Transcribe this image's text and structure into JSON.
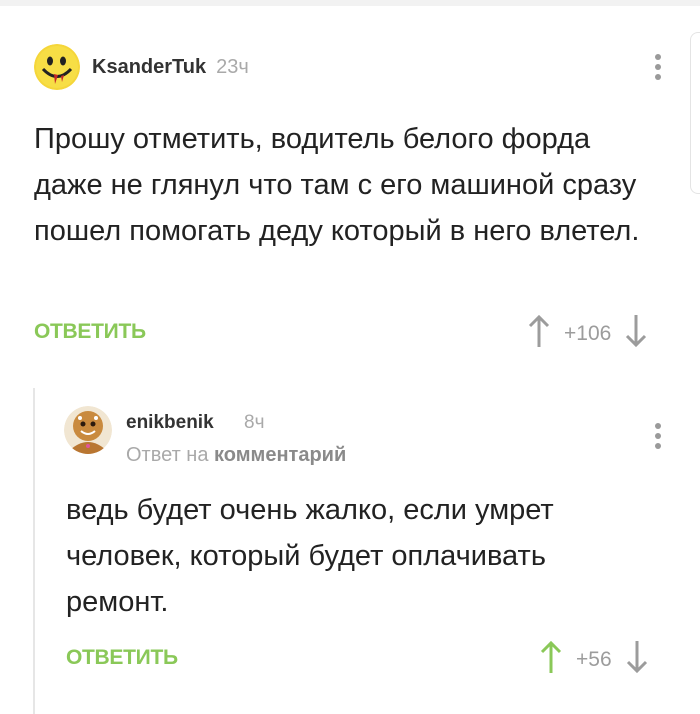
{
  "comments": [
    {
      "username": "KsanderTuk",
      "time": "23ч",
      "avatar_icon": "smiley-avatar-icon",
      "text": "Прошу отметить, водитель белого форда даже не глянул что там с его машиной сразу пошел помогать деду который в него влетел.",
      "reply_label": "ОТВЕТИТЬ",
      "votes": "+106",
      "upvoted": false
    },
    {
      "username": "enikbenik",
      "time": "8ч",
      "avatar_icon": "gingerbread-avatar-icon",
      "reply_to_prefix": "Ответ на",
      "reply_to_target": "комментарий",
      "text": "ведь будет очень жалко, если умрет человек, который будет оплачивать ремонт.",
      "reply_label": "ОТВЕТИТЬ",
      "votes": "+56",
      "upvoted": true
    }
  ],
  "colors": {
    "accent_green": "#8ac858",
    "muted": "#9c9c9c",
    "text": "#222222"
  }
}
